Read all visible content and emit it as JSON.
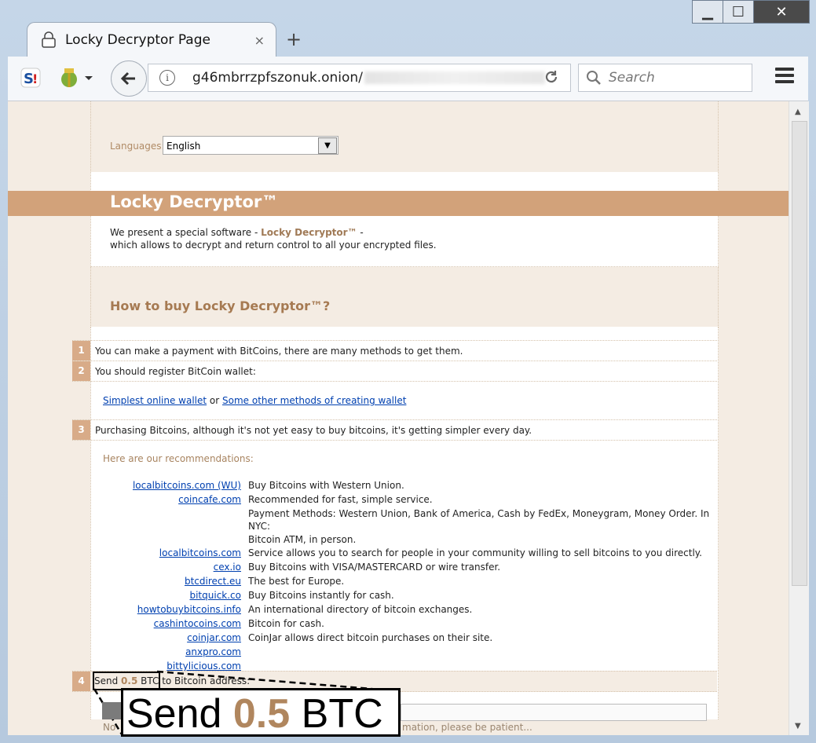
{
  "browser": {
    "tab_title": "Locky Decryptor Page",
    "tab_close": "×",
    "new_tab": "+",
    "url": "g46mbrrzpfszonuk.onion/",
    "search_placeholder": "Search",
    "window_buttons": {
      "minimize": "▁",
      "maximize": "☐",
      "close": "✕"
    }
  },
  "page": {
    "language_label": "Languages:",
    "language_value": "English",
    "title": "Locky Decryptor™",
    "intro_prefix": "We present a special software - ",
    "intro_product": "Locky Decryptor™",
    "intro_suffix": " -",
    "intro_line2": "which allows to decrypt and return control to all your encrypted files.",
    "howto_heading": "How to buy Locky Decryptor™?",
    "steps": [
      {
        "num": "1",
        "text": "You can make a payment with BitCoins, there are many methods to get them."
      },
      {
        "num": "2",
        "text": "You should register BitCoin wallet:"
      },
      {
        "num": "3",
        "text": "Purchasing Bitcoins, although it's not yet easy to buy bitcoins, it's getting simpler every day."
      },
      {
        "num": "4",
        "text_before": "Send ",
        "amount": "0.5",
        "text_after": " BTC",
        "text_tail": " to Bitcoin address:"
      }
    ],
    "wallet_link1": "Simplest online wallet",
    "wallet_or": " or ",
    "wallet_link2": "Some other methods of creating wallet",
    "recommendations_label": "Here are our recommendations:",
    "recommendations": [
      {
        "site": "localbitcoins.com (WU)",
        "desc": "Buy Bitcoins with Western Union."
      },
      {
        "site": "coincafe.com",
        "desc": "Recommended for fast, simple service."
      },
      {
        "site": "",
        "desc": "Payment Methods: Western Union, Bank of America, Cash by FedEx, Moneygram, Money Order. In NYC:"
      },
      {
        "site": "",
        "desc": "Bitcoin ATM, in person."
      },
      {
        "site": "localbitcoins.com",
        "desc": "Service allows you to search for people in your community willing to sell bitcoins to you directly."
      },
      {
        "site": "cex.io",
        "desc": "Buy Bitcoins with VISA/MASTERCARD or wire transfer."
      },
      {
        "site": "btcdirect.eu",
        "desc": "The best for Europe."
      },
      {
        "site": "bitquick.co",
        "desc": "Buy Bitcoins instantly for cash."
      },
      {
        "site": "howtobuybitcoins.info",
        "desc": "An international directory of bitcoin exchanges."
      },
      {
        "site": "cashintocoins.com",
        "desc": "Bitcoin for cash."
      },
      {
        "site": "coinjar.com",
        "desc": "CoinJar allows direct bitcoin purchases on their site."
      },
      {
        "site": "anxpro.com",
        "desc": ""
      },
      {
        "site": "bittylicious.com",
        "desc": ""
      }
    ],
    "zoom_callout": {
      "before": "Send ",
      "amount": "0.5",
      "after": " BTC"
    },
    "partial_left": "No",
    "partial_right": "mation, please be patient..."
  },
  "colors": {
    "accent": "#d2a27a",
    "accent_text": "#a67a52",
    "link": "#0040b0",
    "page_bg": "#f4ece3"
  }
}
